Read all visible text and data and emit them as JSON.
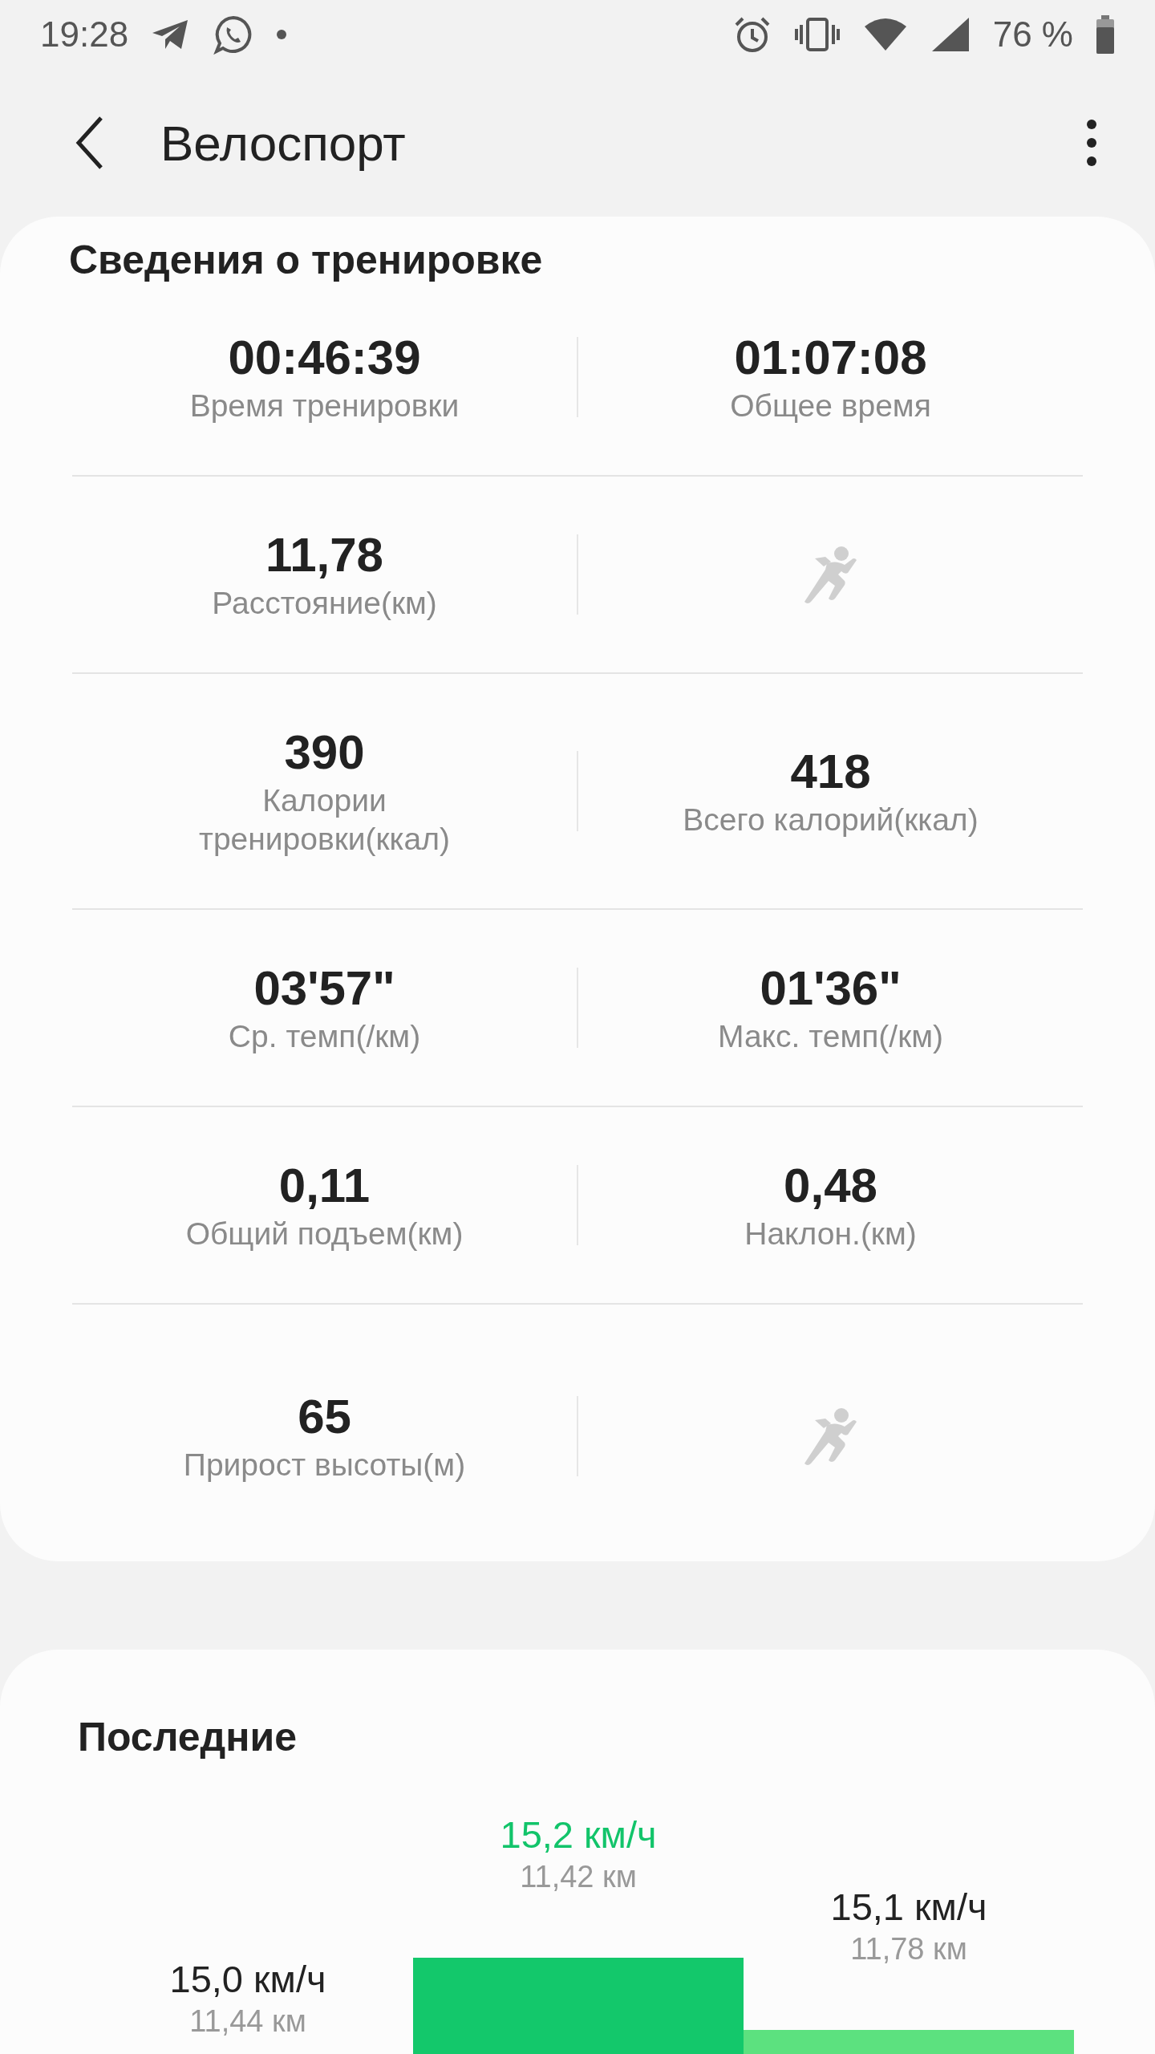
{
  "status_bar": {
    "time": "19:28",
    "battery": "76 %"
  },
  "app_bar": {
    "title": "Велоспорт"
  },
  "workout_card": {
    "title": "Сведения о тренировке",
    "rows": [
      {
        "cells": [
          {
            "kind": "metric",
            "value": "00:46:39",
            "label": "Время тренировки"
          },
          {
            "kind": "metric",
            "value": "01:07:08",
            "label": "Общее время"
          }
        ]
      },
      {
        "cells": [
          {
            "kind": "metric",
            "value": "11,78",
            "label": "Расстояние(км)"
          },
          {
            "kind": "icon"
          }
        ]
      },
      {
        "cells": [
          {
            "kind": "metric",
            "value": "390",
            "label": "Калории\nтренировки(ккал)"
          },
          {
            "kind": "metric",
            "value": "418",
            "label": "Всего калорий(ккал)"
          }
        ]
      },
      {
        "cells": [
          {
            "kind": "metric",
            "value": "03'57\"",
            "label": "Ср. темп(/км)"
          },
          {
            "kind": "metric",
            "value": "01'36\"",
            "label": "Макс. темп(/км)"
          }
        ]
      },
      {
        "cells": [
          {
            "kind": "metric",
            "value": "0,11",
            "label": "Общий подъем(км)"
          },
          {
            "kind": "metric",
            "value": "0,48",
            "label": "Наклон.(км)"
          }
        ]
      },
      {
        "cells": [
          {
            "kind": "metric",
            "value": "65",
            "label": "Прирост высоты(м)"
          },
          {
            "kind": "icon"
          }
        ]
      }
    ]
  },
  "recent_card": {
    "title": "Последние",
    "items": [
      {
        "speed": "15,0 км/ч",
        "distance": "11,44 км",
        "selected": false
      },
      {
        "speed": "15,2 км/ч",
        "distance": "11,42 км",
        "selected": true
      },
      {
        "speed": "15,1 км/ч",
        "distance": "11,78 км",
        "selected": false
      }
    ]
  }
}
